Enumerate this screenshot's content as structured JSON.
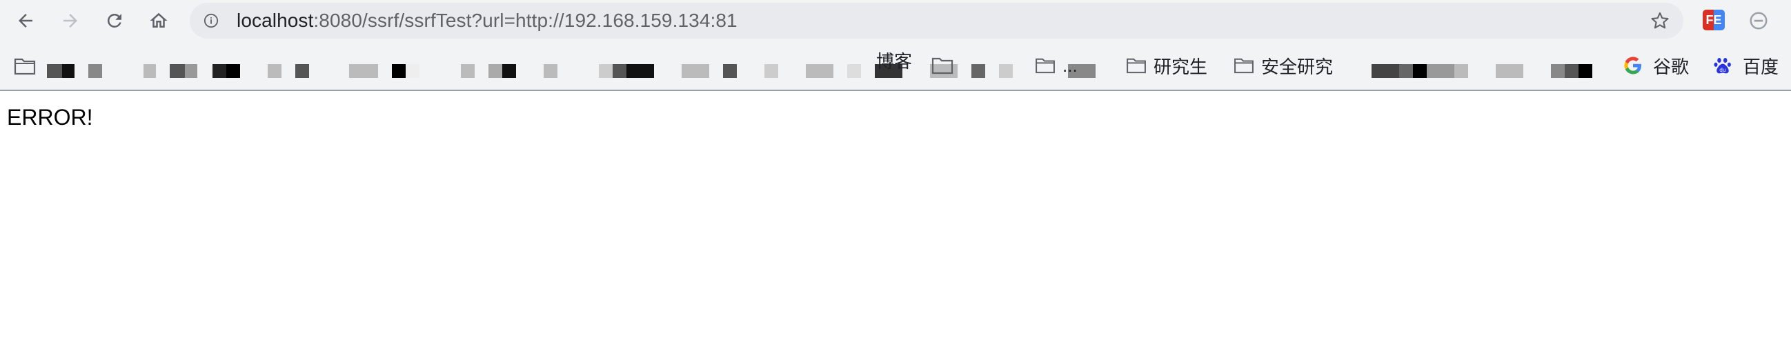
{
  "browser": {
    "url_host": "localhost",
    "url_rest": ":8080/ssrf/ssrfTest?url=http://192.168.159.134:81",
    "extension_label": "FE"
  },
  "bookmarks": {
    "visible_fragments": [
      "博客",
      "...",
      "研究生",
      "安全研究"
    ],
    "google_label": "谷歌",
    "baidu_label": "百度"
  },
  "page": {
    "body_text": "ERROR!"
  },
  "colors": {
    "toolbar_bg": "#f1f3f4",
    "omnibox_bg": "#e8eaed",
    "icon_gray": "#5f6368",
    "fe_red": "#d93025",
    "fe_blue": "#4285f4",
    "baidu_blue": "#2932e1"
  },
  "icons": {
    "back": "arrow-left",
    "forward": "arrow-right",
    "reload": "circular-arrow",
    "home": "house",
    "site_info": "info-circle",
    "bookmark_star": "star-outline",
    "folder": "folder-outline",
    "google": "google-g",
    "baidu": "baidu-paw",
    "extension_block": "minus-circle"
  }
}
